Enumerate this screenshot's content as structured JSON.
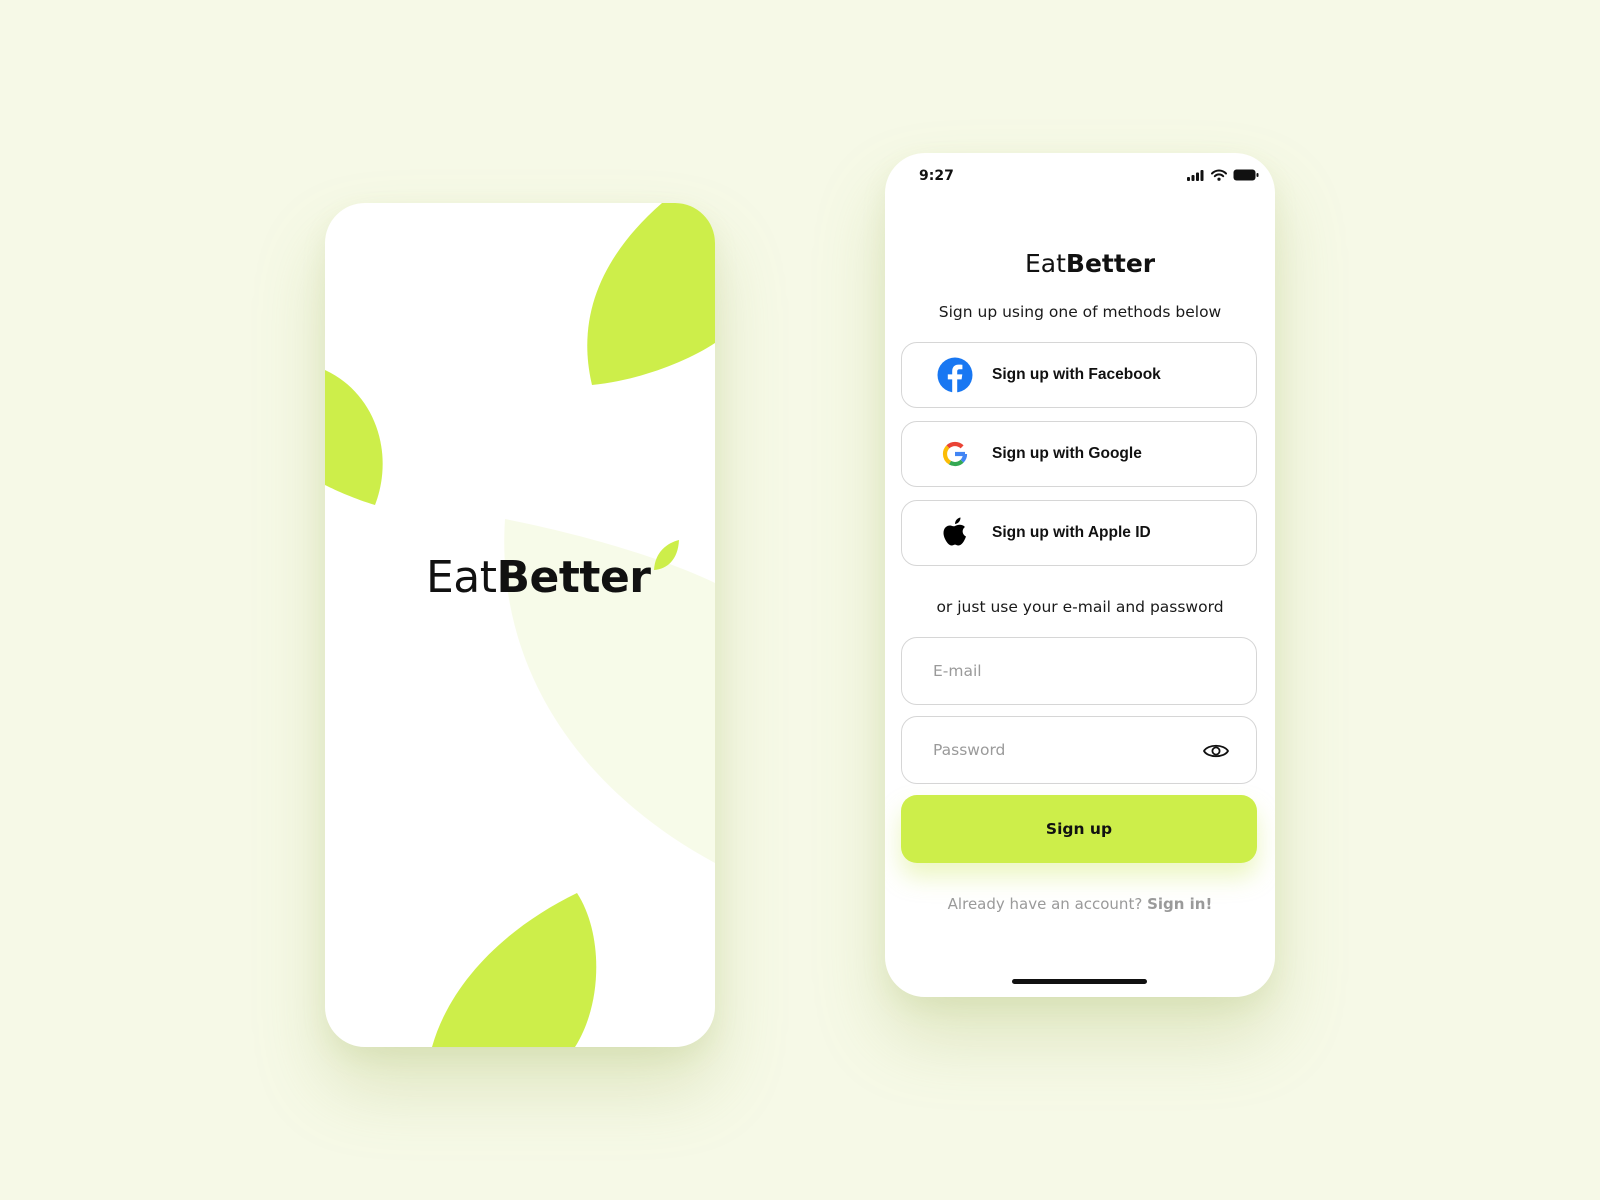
{
  "splash": {
    "logo": {
      "part1": "Eat",
      "part2": "Better"
    }
  },
  "signup": {
    "status": {
      "time": "9:27"
    },
    "logo": {
      "part1": "Eat",
      "part2": "Better"
    },
    "subtitle": "Sign up using one of methods below",
    "buttons": {
      "facebook": "Sign up with Facebook",
      "google": "Sign up with Google",
      "apple": "Sign up with Apple ID"
    },
    "alt_text": "or just use your e-mail and password",
    "email": {
      "placeholder": "E-mail",
      "value": ""
    },
    "password": {
      "placeholder": "Password",
      "value": ""
    },
    "submit": "Sign up",
    "footer": {
      "question": "Already have an account? ",
      "link": "Sign in!"
    }
  },
  "colors": {
    "background": "#f6f9e7",
    "accent": "#cdee4a",
    "facebook": "#1877f2"
  },
  "icons": [
    "facebook-icon",
    "google-icon",
    "apple-icon",
    "eye-icon",
    "leaf-icon",
    "signal-icon",
    "wifi-icon",
    "battery-icon"
  ]
}
